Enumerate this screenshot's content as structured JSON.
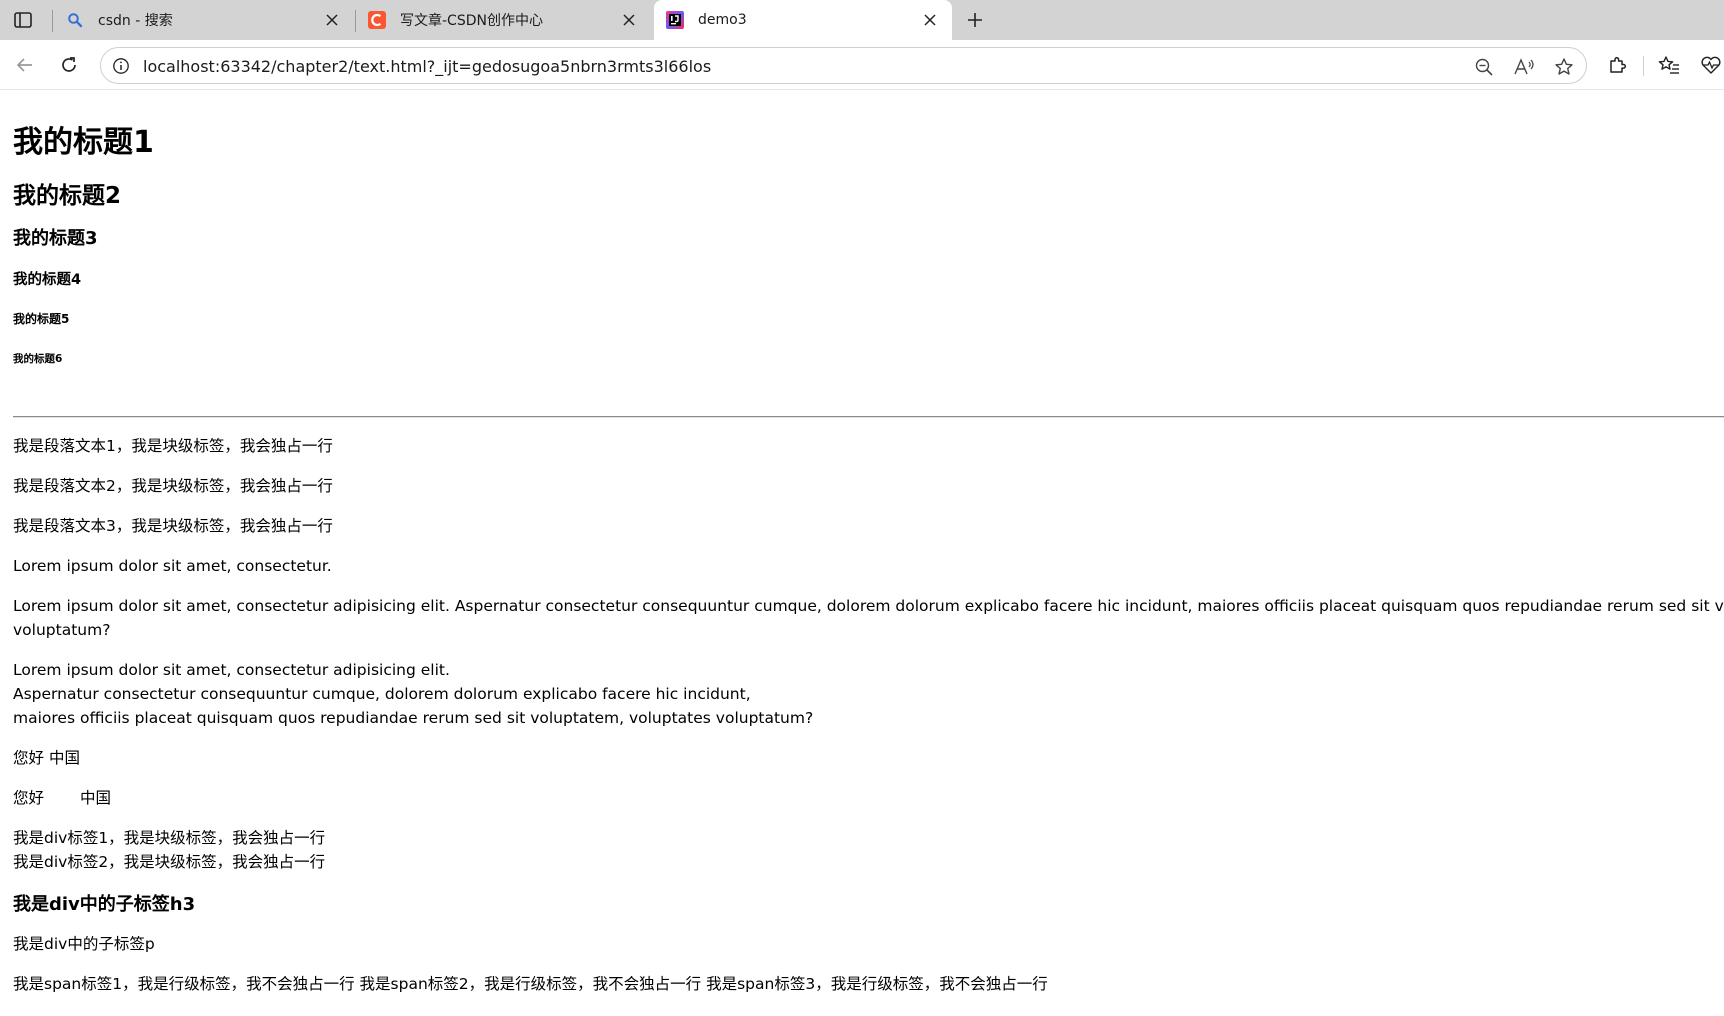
{
  "browser": {
    "tabs": [
      {
        "title": "csdn - 搜索",
        "icon": "search-icon"
      },
      {
        "title": "写文章-CSDN创作中心",
        "icon": "csdn-logo-icon"
      },
      {
        "title": "demo3",
        "icon": "intellij-logo-icon"
      }
    ],
    "active_tab": 2,
    "url": "localhost:63342/chapter2/text.html?_ijt=gedosugoa5nbrn3rmts3l66los",
    "colors": {
      "csdn_brand": "#fc5531",
      "tabstrip": "#d3d3d3",
      "search_icon": "#3a6fd8"
    }
  },
  "page": {
    "h1": "我的标题1",
    "h2": "我的标题2",
    "h3": "我的标题3",
    "h4": "我的标题4",
    "h5": "我的标题5",
    "h6": "我的标题6",
    "paragraphs": [
      "我是段落文本1，我是块级标签，我会独占一行",
      "我是段落文本2，我是块级标签，我会独占一行",
      "我是段落文本3，我是块级标签，我会独占一行"
    ],
    "lorem_short": "Lorem ipsum dolor sit amet, consectetur.",
    "lorem_long_line1": "Lorem ipsum dolor sit amet, consectetur adipisicing elit. Aspernatur consectetur consequuntur cumque, dolorem dolorum explicabo facere hic incidunt, maiores officiis placeat quisquam quos repudiandae rerum sed sit voluptatem",
    "lorem_long_line2": "voluptatum?",
    "pre_lines": [
      "Lorem ipsum dolor sit amet, consectetur adipisicing elit.",
      "Aspernatur consectetur consequuntur cumque, dolorem dolorum explicabo facere hic incidunt,",
      "maiores officiis placeat quisquam quos repudiandae rerum sed sit voluptatem, voluptates voluptatum?"
    ],
    "hello_a": {
      "word1": "您好",
      "word2": "中国"
    },
    "hello_b": {
      "word1": "您好",
      "word2": "中国"
    },
    "divs": [
      "我是div标签1，我是块级标签，我会独占一行",
      "我是div标签2，我是块级标签，我会独占一行"
    ],
    "div_h3": "我是div中的子标签h3",
    "div_p": "我是div中的子标签p",
    "spans": [
      "我是span标签1，我是行级标签，我不会独占一行",
      "我是span标签2，我是行级标签，我不会独占一行",
      "我是span标签3，我是行级标签，我不会独占一行"
    ]
  }
}
